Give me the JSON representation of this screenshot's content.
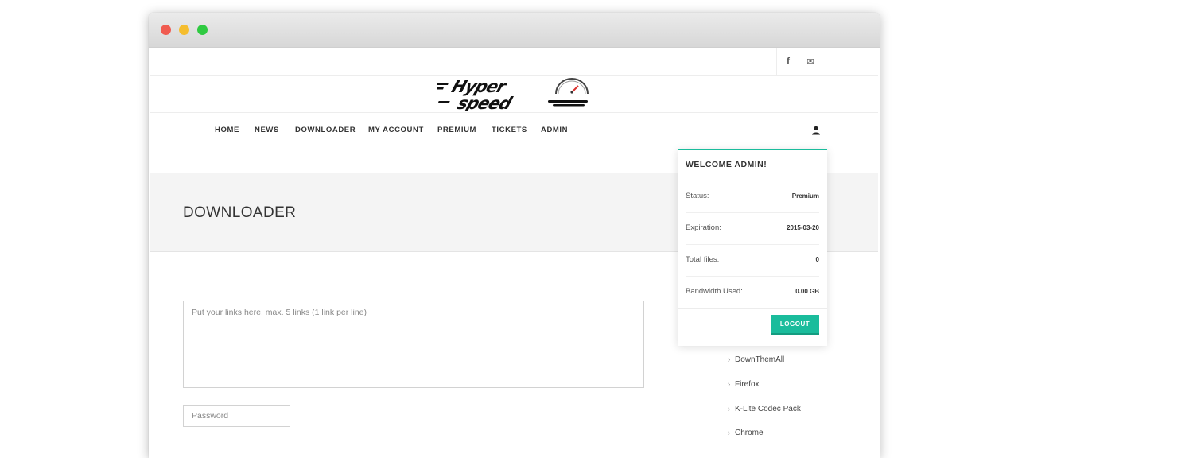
{
  "social": {
    "facebook_glyph": "f",
    "mail_glyph": "✉"
  },
  "nav": {
    "items": [
      "HOME",
      "NEWS",
      "DOWNLOADER",
      "MY ACCOUNT",
      "PREMIUM",
      "TICKETS",
      "ADMIN"
    ]
  },
  "page_title": "DOWNLOADER",
  "form": {
    "links_placeholder": "Put your links here, max. 5 links (1 link per line)",
    "password_placeholder": "Password"
  },
  "sidebar": {
    "items": [
      "DownThemAll",
      "Firefox",
      "K-Lite Codec Pack",
      "Chrome"
    ]
  },
  "user_menu": {
    "title": "WELCOME ADMIN!",
    "rows": [
      {
        "label": "Status:",
        "value": "Premium"
      },
      {
        "label": "Expiration:",
        "value": "2015-03-20"
      },
      {
        "label": "Total files:",
        "value": "0"
      },
      {
        "label": "Bandwidth Used:",
        "value": "0.00 GB"
      }
    ],
    "logout_label": "LOGOUT"
  },
  "colors": {
    "accent": "#1abc9c",
    "traffic_red": "#f05b50",
    "traffic_yellow": "#f5bd2e",
    "traffic_green": "#2fca41"
  }
}
